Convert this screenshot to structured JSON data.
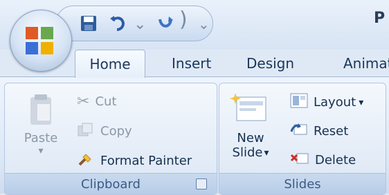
{
  "title": {
    "visible_text": "P"
  },
  "tabs": [
    "Home",
    "Insert",
    "Design",
    "Animat"
  ],
  "clipboard": {
    "paste_label": "Paste",
    "cut_label": "Cut",
    "copy_label": "Copy",
    "format_painter_label": "Format Painter",
    "group_label": "Clipboard"
  },
  "slides": {
    "new_slide_line1": "New",
    "new_slide_line2": "Slide",
    "layout_label": "Layout",
    "reset_label": "Reset",
    "delete_label": "Delete",
    "group_label": "Slides"
  },
  "icons": {
    "office": "office-logo-icon",
    "save": "save-icon",
    "undo": "undo-icon",
    "redo": "redo-icon",
    "qat_more": "dropdown-icon",
    "paste": "paste-icon",
    "cut": "scissors-icon",
    "copy": "copy-icon",
    "format_painter": "paintbrush-icon",
    "new_slide": "new-slide-icon",
    "layout": "layout-icon",
    "reset": "reset-icon",
    "delete": "delete-icon"
  },
  "colors": {
    "accent_blue": "#1b3659",
    "ribbon_bg": "#dde8f6",
    "disabled_text": "#8b98a8"
  }
}
